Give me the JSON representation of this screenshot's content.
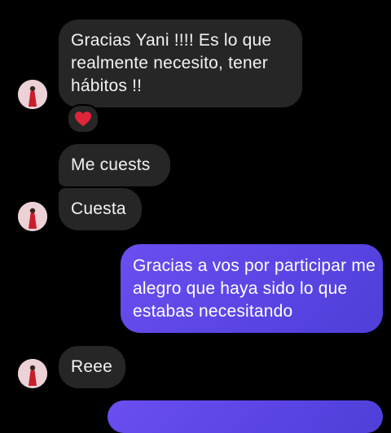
{
  "conversation": {
    "messages": [
      {
        "sender": "contact",
        "text": "Gracias Yani !!!! Es lo que realmente necesito, tener hábitos !!",
        "reaction_icon": "red-heart-icon"
      },
      {
        "sender": "contact",
        "text": "Me cuests"
      },
      {
        "sender": "contact",
        "text": "Cuesta"
      },
      {
        "sender": "me",
        "text": "Gracias a vos por participar me alegro que haya sido lo que estabas necesitando"
      },
      {
        "sender": "contact",
        "text": "Reee"
      }
    ]
  },
  "colors": {
    "background": "#000000",
    "incoming_bubble": "#262626",
    "outgoing_bubble_start": "#6b4ef0",
    "outgoing_bubble_end": "#4f3fd8",
    "reaction_heart": "#e0243a"
  },
  "icons": {
    "avatar": "contact-avatar",
    "reaction": "red-heart-icon"
  }
}
